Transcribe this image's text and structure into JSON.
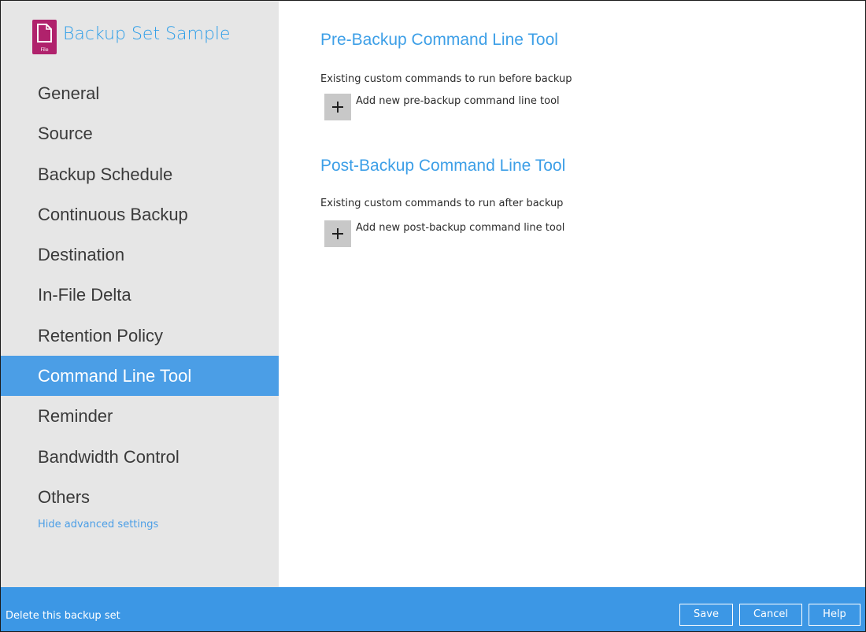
{
  "sidebar": {
    "set_title": "Backup Set Sample",
    "set_icon": {
      "name": "file-icon",
      "caption": "File",
      "color": "#b0226c"
    },
    "items": [
      {
        "label": "General",
        "active": false
      },
      {
        "label": "Source",
        "active": false
      },
      {
        "label": "Backup Schedule",
        "active": false
      },
      {
        "label": "Continuous Backup",
        "active": false
      },
      {
        "label": "Destination",
        "active": false
      },
      {
        "label": "In-File Delta",
        "active": false
      },
      {
        "label": "Retention Policy",
        "active": false
      },
      {
        "label": "Command Line Tool",
        "active": true
      },
      {
        "label": "Reminder",
        "active": false
      },
      {
        "label": "Bandwidth Control",
        "active": false
      },
      {
        "label": "Others",
        "active": false
      }
    ],
    "hide_advanced": "Hide advanced settings"
  },
  "main": {
    "pre": {
      "title": "Pre-Backup Command Line Tool",
      "description": "Existing custom commands to run before backup",
      "add_label": "Add new pre-backup command line tool"
    },
    "post": {
      "title": "Post-Backup Command Line Tool",
      "description": "Existing custom commands to run after backup",
      "add_label": "Add new post-backup command line tool"
    }
  },
  "footer": {
    "delete_label": "Delete this backup set",
    "save_label": "Save",
    "cancel_label": "Cancel",
    "help_label": "Help"
  },
  "colors": {
    "accent": "#3c97e5",
    "sidebar_bg": "#e6e6e6",
    "active_item_bg": "#4b9ee6",
    "title_blue": "#3d9fe7",
    "icon_magenta": "#b0226c"
  }
}
